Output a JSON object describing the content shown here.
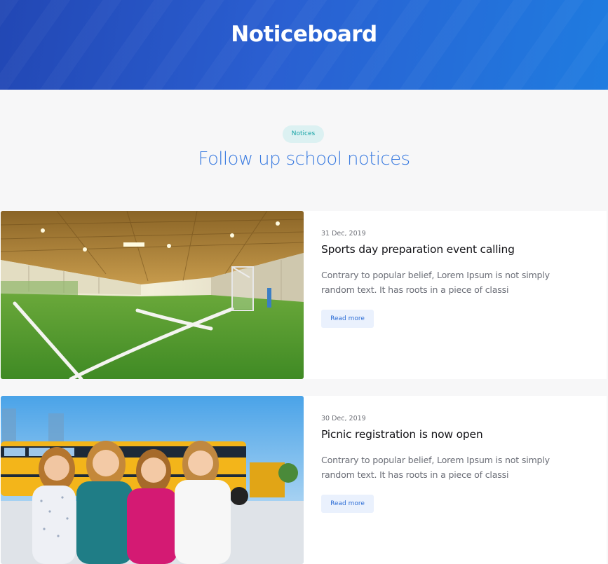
{
  "hero": {
    "title": "Noticeboard"
  },
  "section": {
    "badge": "Notices",
    "title": "Follow up school notices"
  },
  "notices": [
    {
      "date": "31 Dec, 2019",
      "title": "Sports day preparation event calling",
      "excerpt": "Contrary to popular belief, Lorem Ipsum is not simply random text. It has roots in a piece of classi",
      "button": "Read more",
      "image": "indoor-football-field-photo"
    },
    {
      "date": "30 Dec, 2019",
      "title": "Picnic registration is now open",
      "excerpt": "Contrary to popular belief, Lorem Ipsum is not simply random text. It has roots in a piece of classi",
      "button": "Read more",
      "image": "children-school-bus-photo"
    }
  ],
  "colors": {
    "hero_start": "#2247b4",
    "hero_end": "#1f7ce0",
    "accent": "#3a7be0",
    "badge_bg": "#dcf1f2",
    "badge_text": "#17a3a6",
    "button_bg": "#eaf1fd"
  }
}
